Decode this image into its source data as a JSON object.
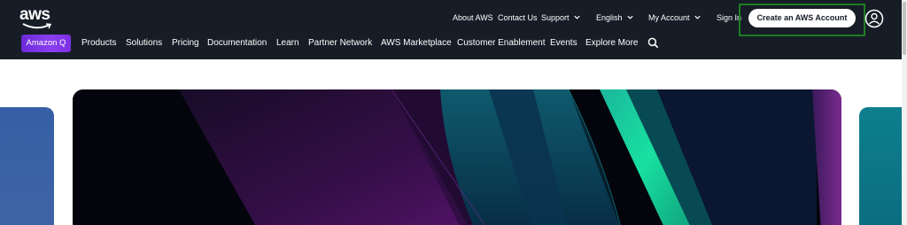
{
  "header": {
    "logo_text": "aws",
    "utility_nav": [
      {
        "label": "About AWS",
        "dropdown": false
      },
      {
        "label": "Contact Us",
        "dropdown": false
      },
      {
        "label": "Support",
        "dropdown": true
      },
      {
        "label": "English",
        "dropdown": true
      },
      {
        "label": "My Account",
        "dropdown": true
      },
      {
        "label": "Sign In",
        "dropdown": false
      }
    ],
    "create_account_label": "Create an AWS Account",
    "profile_icon": "user-circle-icon",
    "amazon_q_label": "Amazon Q",
    "main_nav": [
      "Products",
      "Solutions",
      "Pricing",
      "Documentation",
      "Learn",
      "Partner Network",
      "AWS Marketplace",
      "Customer Enablement",
      "Events",
      "Explore More"
    ],
    "search_icon": "search-icon"
  },
  "colors": {
    "header_bg": "#161d26",
    "amazon_q": "#7c2fe3",
    "highlight": "#1f7d22",
    "card_left": "#3f64a5",
    "card_right": "#0b6d7f"
  }
}
